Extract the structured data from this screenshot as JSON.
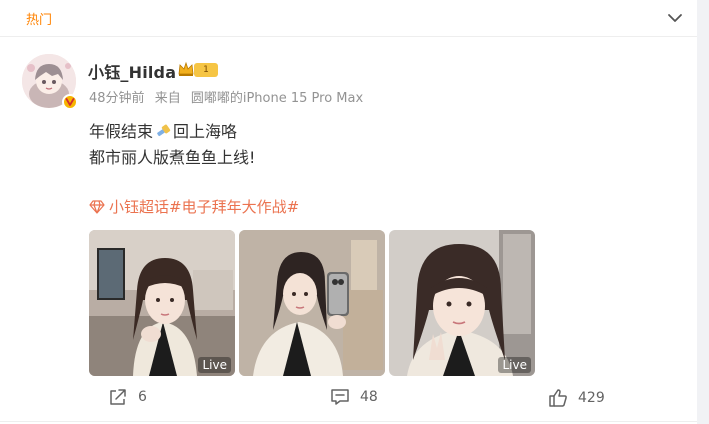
{
  "feed": {
    "section_label": "热门"
  },
  "post": {
    "author": {
      "name": "小钰_Hilda",
      "level": "1"
    },
    "meta": {
      "time": "48分钟前",
      "source_prefix": "来自",
      "source": "圆嘟嘟的iPhone 15 Pro Max"
    },
    "text": {
      "line1_a": "年假结束",
      "line1_b": "回上海咯",
      "line2": "都市丽人版煮鱼鱼上线!"
    },
    "topics": "小钰超话#电子拜年大作战#",
    "images": [
      {
        "badge": "Live"
      },
      {
        "badge": ""
      },
      {
        "badge": "Live"
      }
    ],
    "actions": {
      "repost": "6",
      "comment": "48",
      "like": "429"
    }
  },
  "colors": {
    "accent": "#ff8200",
    "topic": "#eb7350",
    "vip": "#f6c544"
  }
}
